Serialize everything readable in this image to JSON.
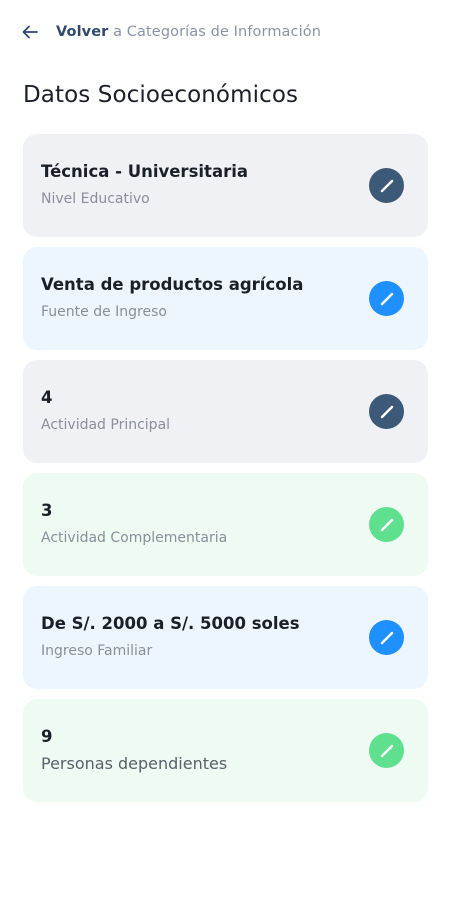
{
  "header": {
    "back_strong": "Volver",
    "back_rest": " a Categorías de Información"
  },
  "page_title": "Datos Socioeconómicos",
  "colors": {
    "navy_button": "#3c5a78",
    "blue_button": "#1e90ff",
    "green_button": "#5fe08f",
    "gray_card": "#eff1f5",
    "blue_card": "#edf6ff",
    "green_card": "#eefbf2"
  },
  "icons": {
    "back": "arrow-left-icon",
    "edit": "pencil-icon"
  },
  "cards": [
    {
      "value": "Técnica - Universitaria",
      "label": "Nivel Educativo"
    },
    {
      "value": "Venta de productos agrícola",
      "label": "Fuente de Ingreso"
    },
    {
      "value": "4",
      "label": "Actividad Principal"
    },
    {
      "value": "3",
      "label": "Actividad Complementaria"
    },
    {
      "value": "De S/. 2000 a S/. 5000 soles",
      "label": "Ingreso Familiar"
    },
    {
      "value": "9",
      "label": "Personas dependientes"
    }
  ]
}
